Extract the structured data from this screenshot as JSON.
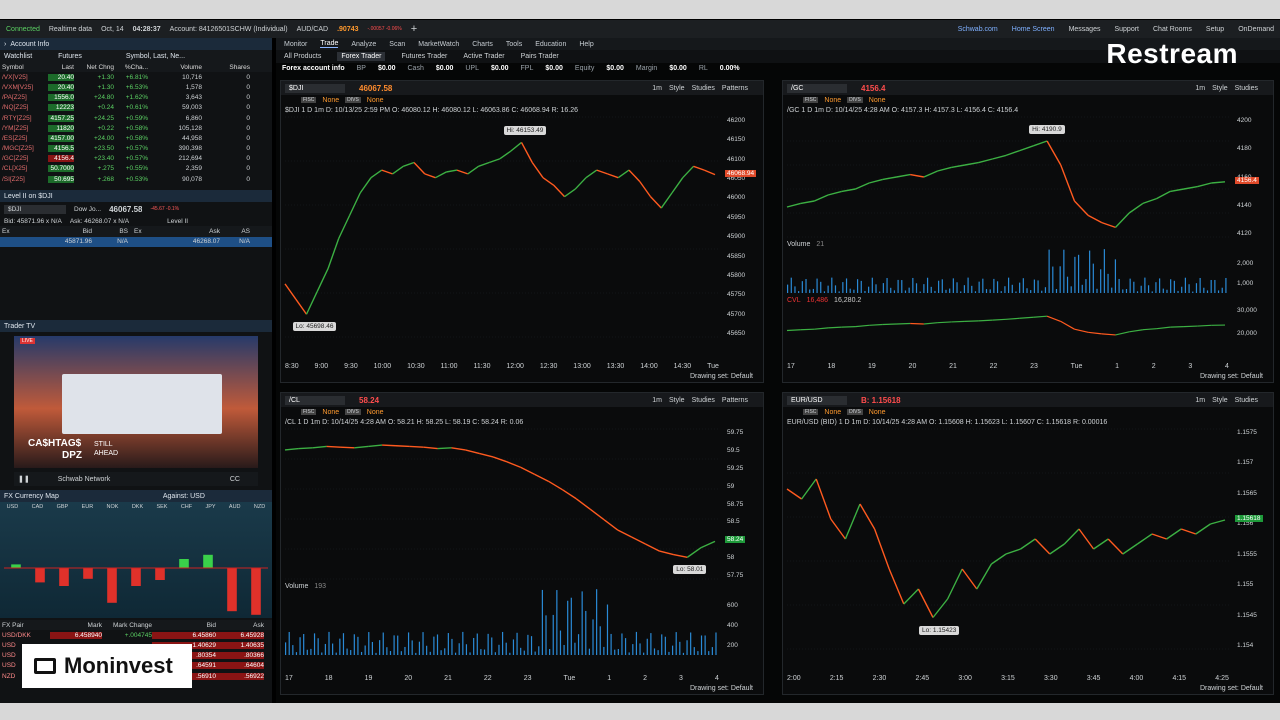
{
  "topbar": {
    "status": "Connected",
    "realtime": "Realtime data",
    "date": "Oct, 14",
    "time": "04:28:37",
    "account": "Account: 84126501SCHW (Individual)",
    "pair": "AUD/CAD",
    "price": ".90743",
    "change": "-.00057 -0.06%",
    "right": [
      "Schwab.com",
      "Home Screen",
      "Messages",
      "Support",
      "Chat Rooms",
      "Setup",
      "OnDemand"
    ]
  },
  "left": {
    "account_info": "Account Info",
    "watchlist": "Watchlist",
    "futures": "Futures",
    "symbol_last": "Symbol, Last, Ne...",
    "cols": [
      "Symbol",
      "Last",
      "Net Chng",
      "%Cha...",
      "Volume",
      "Shares"
    ],
    "rows": [
      [
        "/VX[V25]",
        "20.40",
        "+1.30",
        "+6.81%",
        "10,716",
        "0"
      ],
      [
        "/VXM[V25]",
        "20.40",
        "+1.30",
        "+6.53%",
        "1,578",
        "0"
      ],
      [
        "/PA[Z25]",
        "1556.0",
        "+24.80",
        "+1.62%",
        "3,643",
        "0"
      ],
      [
        "/NQ[Z25]",
        "12223",
        "+0.24",
        "+0.61%",
        "59,003",
        "0"
      ],
      [
        "/RTY[Z25]",
        "4157.25",
        "+24.25",
        "+0.59%",
        "6,860",
        "0"
      ],
      [
        "/YM[Z25]",
        "11820",
        "+0.22",
        "+0.58%",
        "105,128",
        "0"
      ],
      [
        "/ES[Z25]",
        "4157.00",
        "+24.00",
        "+0.58%",
        "44,958",
        "0"
      ],
      [
        "/MGC[Z25]",
        "4156.5",
        "+23.50",
        "+0.57%",
        "390,398",
        "0"
      ],
      [
        "/GC[Z25]",
        "4156.4",
        "+23.40",
        "+0.57%",
        "212,694",
        "0"
      ],
      [
        "/CL[X25]",
        "50.7000",
        "+.275",
        "+0.55%",
        "2,359",
        "0"
      ],
      [
        "/SI[Z25]",
        "50.695",
        "+.268",
        "+0.53%",
        "90,078",
        "0"
      ]
    ],
    "level2": "Level II on $DJI",
    "l2_symbol": "$DJI",
    "l2_name": "Dow Jo...",
    "l2_price": "46067.58",
    "l2_small": "-45.67 -0.1%",
    "bid": "Bid: 45871.96 x N/A",
    "ask": "Ask: 46268.07 x N/A",
    "level_ii": "Level II",
    "l2_cols": [
      "Ex",
      "Bid",
      "BS",
      "Ex",
      "Ask",
      "AS"
    ],
    "l2_row": [
      "45871.96",
      "N/A",
      "46268.07",
      "N/A"
    ],
    "trader_tv": "Trader TV",
    "tv_text1": "CA$HTAG$",
    "tv_text2": "DPZ",
    "tv_text3": "STILL",
    "tv_text4": "AHEAD",
    "tv_net": "Schwab Network",
    "tv_live": "LIVE",
    "fx_map": "FX Currency Map",
    "against": "Against: USD",
    "currencies": [
      "USD",
      "CAD",
      "GBP",
      "EUR",
      "NOK",
      "DKK",
      "SEK",
      "CHF",
      "JPY",
      "AUD",
      "NZD"
    ],
    "fx_cols": [
      "FX Pair",
      "Mark",
      "Mark Change",
      "Bid",
      "Ask"
    ],
    "fx_rows": [
      [
        "USD/DKK",
        "6.458940",
        "+.004745",
        "6.45860",
        "6.45928"
      ],
      [
        "USD",
        "",
        "",
        "1.40629",
        "1.40635"
      ],
      [
        "USD",
        "",
        "",
        ".80354",
        ".80366"
      ],
      [
        "USD",
        "",
        "",
        ".64591",
        ".64604"
      ],
      [
        "NZD",
        "",
        "",
        ".56910",
        ".56922"
      ]
    ],
    "fx_levels": [
      0.06,
      -0.24,
      -0.3,
      -0.18,
      -0.58,
      -0.3,
      -0.2,
      0.15,
      0.22,
      -0.72,
      -0.78
    ]
  },
  "main": {
    "menu": [
      "Monitor",
      "Trade",
      "Analyze",
      "Scan",
      "MarketWatch",
      "Charts",
      "Tools",
      "Education",
      "Help"
    ],
    "sub": [
      "All Products",
      "Forex Trader",
      "Futures Trader",
      "Active Trader",
      "Pairs Trader"
    ],
    "info": [
      "Forex account info",
      "BP",
      "$0.00",
      "Cash",
      "$0.00",
      "UPL",
      "$0.00",
      "FPL",
      "$0.00",
      "Equity",
      "$0.00",
      "Margin",
      "$0.00",
      "RL",
      "0.00%"
    ]
  },
  "charts": [
    {
      "symbol": "$DJI",
      "price": "46067.58",
      "ohlc": "$DJI 1 D 1m  D: 10/13/25 2:59 PM  O: 46080.12  H: 46080.12  L: 46063.86  C: 46068.94  R: 16.26",
      "hi": "Hi: 46153.49",
      "lo": "Lo: 45698.46",
      "last_tag": "46068.94",
      "yticks": [
        "46200",
        "46150",
        "46100",
        "46050",
        "46000",
        "45950",
        "45900",
        "45850",
        "45800",
        "45750",
        "45700",
        "45650"
      ],
      "xticks": [
        "8:30",
        "9:00",
        "9:30",
        "10:00",
        "10:30",
        "11:00",
        "11:30",
        "12:00",
        "12:30",
        "13:00",
        "13:30",
        "14:00",
        "14:30",
        "Tue"
      ],
      "series": [
        45780,
        45740,
        45700,
        45760,
        45820,
        45900,
        45960,
        46020,
        46060,
        46080,
        46070,
        46090,
        46100,
        46070,
        46060,
        46075,
        46080,
        46070,
        46090,
        46100,
        46110,
        46130,
        46153,
        46100,
        46060,
        46040,
        46010,
        46030,
        46060,
        46080,
        46070,
        46060,
        46080,
        46050,
        46010,
        45980,
        46020,
        46060,
        46090,
        46080,
        46068
      ],
      "ymin": 45640,
      "ymax": 46220,
      "type": "line",
      "draw": "Drawing set: Default",
      "studies": "Studies",
      "style": "Style",
      "tf": "1m",
      "patterns": "Patterns"
    },
    {
      "symbol": "/GC",
      "price": "4156.4",
      "ohlc": "/GC 1 D 1m  D: 10/14/25 4:28 AM  O: 4157.3  H: 4157.3  L: 4156.4  C: 4156.4",
      "hi": "Hi: 4190.9",
      "last_tag": "4156.4",
      "yticks": [
        "4200",
        "4180",
        "4160",
        "4140",
        "4120"
      ],
      "xticks": [
        "17",
        "18",
        "19",
        "20",
        "21",
        "22",
        "23",
        "Tue",
        "1",
        "2",
        "3",
        "4"
      ],
      "series": [
        4135,
        4138,
        4140,
        4145,
        4148,
        4150,
        4155,
        4158,
        4160,
        4162,
        4160,
        4165,
        4168,
        4170,
        4172,
        4175,
        4178,
        4182,
        4186,
        4190,
        4170,
        4140,
        4128,
        4122,
        4118,
        4130,
        4138,
        4142,
        4148,
        4150,
        4152,
        4155,
        4156
      ],
      "ymin": 4110,
      "ymax": 4210,
      "volume_label": "Volume",
      "volume_n": "21",
      "vol_ticks": [
        "2,000",
        "1,000"
      ],
      "cvl_label": "CVL",
      "cvl_v1": "16,486",
      "cvl_v2": "16,280.2",
      "cvl_ticks": [
        "30,000",
        "20,000"
      ],
      "cvl_tag": "16,486",
      "draw": "Drawing set: Default",
      "studies": "Studies",
      "style": "Style",
      "tf": "1m"
    },
    {
      "symbol": "/CL",
      "price": "58.24",
      "ohlc": "/CL 1 D 1m  D: 10/14/25 4:28 AM  O: 58.21  H: 58.25  L: 58.19  C: 58.24  R: 0.06",
      "lo": "Lo: 58.01",
      "last_tag": "58.24",
      "yticks": [
        "59.75",
        "59.5",
        "59.25",
        "59",
        "58.75",
        "58.5",
        "58.25",
        "58",
        "57.75"
      ],
      "xticks": [
        "17",
        "18",
        "19",
        "20",
        "21",
        "22",
        "23",
        "Tue",
        "1",
        "2",
        "3",
        "4"
      ],
      "series": [
        59.55,
        59.57,
        59.58,
        59.6,
        59.59,
        59.58,
        59.6,
        59.62,
        59.61,
        59.6,
        59.59,
        59.57,
        59.58,
        59.55,
        59.5,
        59.45,
        59.38,
        59.3,
        59.2,
        59.1,
        58.98,
        58.85,
        58.7,
        58.55,
        58.4,
        58.3,
        58.2,
        58.1,
        58.05,
        58.01,
        58.15,
        58.24
      ],
      "ymin": 57.7,
      "ymax": 59.85,
      "volume_label": "Volume",
      "volume_n": "193",
      "vol_ticks": [
        "600",
        "400",
        "200"
      ],
      "draw": "Drawing set: Default",
      "studies": "Studies",
      "style": "Style",
      "tf": "1m",
      "patterns": "Patterns"
    },
    {
      "symbol": "EUR/USD",
      "price": "B: 1.15618",
      "ohlc": "EUR/USD (BID) 1 D 1m  D: 10/14/25 4:28 AM  O: 1.15608  H: 1.15623  L: 1.15607  C: 1.15618  R: 0.00016",
      "lo": "Lo: 1.15423",
      "last_tag": "1.15618",
      "yticks": [
        "1.1575",
        "1.157",
        "1.1565",
        "1.156",
        "1.1555",
        "1.155",
        "1.1545",
        "1.154"
      ],
      "xticks": [
        "2:00",
        "2:15",
        "2:30",
        "2:45",
        "3:00",
        "3:15",
        "3:30",
        "3:45",
        "4:00",
        "4:15",
        "4:25"
      ],
      "series": [
        1.1568,
        1.1566,
        1.157,
        1.1562,
        1.1558,
        1.1565,
        1.156,
        1.1552,
        1.1545,
        1.1548,
        1.15423,
        1.1546,
        1.1552,
        1.1548,
        1.1553,
        1.1555,
        1.1556,
        1.1558,
        1.1555,
        1.1557,
        1.156,
        1.1556,
        1.1558,
        1.1555,
        1.1557,
        1.1559,
        1.1558,
        1.156,
        1.1559,
        1.1561,
        1.15618
      ],
      "ymin": 1.1536,
      "ymax": 1.158,
      "draw": "Drawing set: Default",
      "studies": "Studies",
      "style": "Style",
      "tf": "1m"
    }
  ],
  "labels": {
    "fiscal": "FISC",
    "divs": "DIVS",
    "none": "None",
    "restream": "Restream",
    "moninvest": "Moninvest"
  },
  "colors": {
    "up": "#3cb043",
    "down": "#ff5a1f",
    "accent": "#ff9a2e",
    "bg": "#050606"
  }
}
